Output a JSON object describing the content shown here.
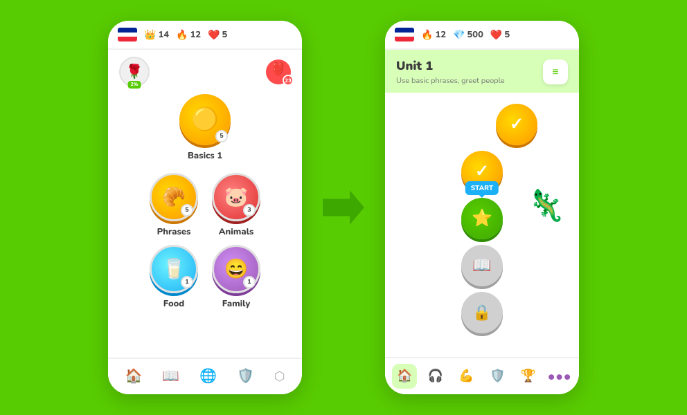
{
  "background_color": "#58cc02",
  "arrow": "→",
  "phone1": {
    "topbar": {
      "flag": "FR",
      "stats": [
        {
          "icon": "👑",
          "value": "14",
          "type": "crown"
        },
        {
          "icon": "🔥",
          "value": "12",
          "type": "fire"
        },
        {
          "icon": "❤️",
          "value": "5",
          "type": "heart"
        }
      ]
    },
    "avatar": {
      "emoji": "🌹",
      "badge_text": "2%"
    },
    "broken_heart": {
      "count": "23"
    },
    "lessons": [
      {
        "id": "basics1",
        "label": "Basics 1",
        "emoji": "⭕",
        "badge": "5",
        "style": "basics",
        "row": "single"
      },
      {
        "id": "phrases",
        "label": "Phrases",
        "emoji": "🥐",
        "badge": "5",
        "style": "phrases",
        "row": "pair"
      },
      {
        "id": "animals",
        "label": "Animals",
        "emoji": "🐷",
        "badge": "3",
        "style": "animals",
        "row": "pair"
      },
      {
        "id": "food",
        "label": "Food",
        "emoji": "🥛",
        "badge": "1",
        "style": "food",
        "row": "pair2"
      },
      {
        "id": "family",
        "label": "Family",
        "emoji": "😄",
        "badge": "1",
        "style": "family",
        "row": "pair2"
      }
    ],
    "bottomnav": [
      {
        "icon": "🏠",
        "label": "home",
        "active": true
      },
      {
        "icon": "📖",
        "label": "book",
        "active": false
      },
      {
        "icon": "🌐",
        "label": "globe",
        "active": false
      },
      {
        "icon": "🛡️",
        "label": "shield",
        "active": false
      },
      {
        "icon": "⬡",
        "label": "hex",
        "active": false
      }
    ]
  },
  "phone2": {
    "topbar": {
      "flag": "FR",
      "stats": [
        {
          "icon": "🔥",
          "value": "12",
          "type": "fire"
        },
        {
          "icon": "💎",
          "value": "500",
          "type": "gem"
        },
        {
          "icon": "❤️",
          "value": "5",
          "type": "heart"
        }
      ]
    },
    "unit": {
      "title": "Unit 1",
      "subtitle": "Use basic phrases, greet people"
    },
    "nodes": [
      {
        "type": "completed",
        "emoji": "✓",
        "offset": "right"
      },
      {
        "type": "completed",
        "emoji": "✓",
        "offset": "center"
      },
      {
        "type": "start",
        "emoji": "⭐",
        "label": "START",
        "offset": "center"
      },
      {
        "type": "book",
        "emoji": "📖",
        "offset": "center"
      },
      {
        "type": "locked",
        "emoji": "🔒",
        "offset": "center"
      }
    ],
    "bottomnav": [
      {
        "icon": "🏠",
        "color": "green",
        "active": true
      },
      {
        "icon": "🎧",
        "color": "orange",
        "active": false
      },
      {
        "icon": "💪",
        "color": "blue",
        "active": false
      },
      {
        "icon": "🛡️",
        "color": "yellow",
        "active": false
      },
      {
        "icon": "🏆",
        "color": "yellow",
        "active": false
      },
      {
        "icon": "⋯",
        "color": "purple",
        "active": false
      }
    ]
  }
}
